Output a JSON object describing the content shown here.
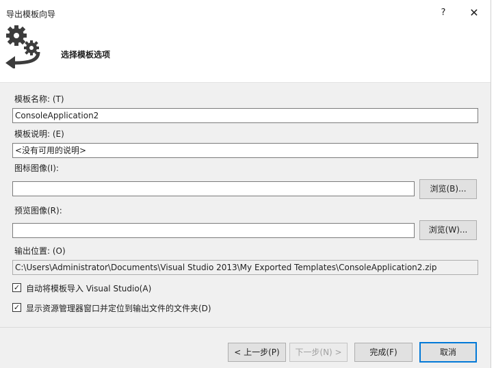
{
  "window": {
    "title": "导出模板向导",
    "help_glyph": "?",
    "close_glyph": "✕"
  },
  "header": {
    "title": "选择模板选项",
    "icon": "gears-export-icon"
  },
  "form": {
    "template_name": {
      "label": "模板名称: (T)",
      "value": "ConsoleApplication2"
    },
    "template_description": {
      "label": "模板说明: (E)",
      "value": "<没有可用的说明>"
    },
    "icon_image": {
      "label": "图标图像(I):",
      "value": "",
      "browse_label": "浏览(B)..."
    },
    "preview_image": {
      "label": "预览图像(R):",
      "value": "",
      "browse_label": "浏览(W)..."
    },
    "output_location": {
      "label": "输出位置: (O)",
      "value": "C:\\Users\\Administrator\\Documents\\Visual Studio 2013\\My Exported Templates\\ConsoleApplication2.zip"
    },
    "auto_import": {
      "label": "自动将模板导入 Visual Studio(A)",
      "checked": true
    },
    "show_in_explorer": {
      "label": "显示资源管理器窗口并定位到输出文件的文件夹(D)",
      "checked": true
    }
  },
  "footer": {
    "prev_label": "< 上一步(P)",
    "next_label": "下一步(N) >",
    "finish_label": "完成(F)",
    "cancel_label": "取消"
  },
  "colors": {
    "accent": "#0078d7",
    "dialog_bg": "#f0f0f0",
    "header_bg": "#ffffff"
  }
}
